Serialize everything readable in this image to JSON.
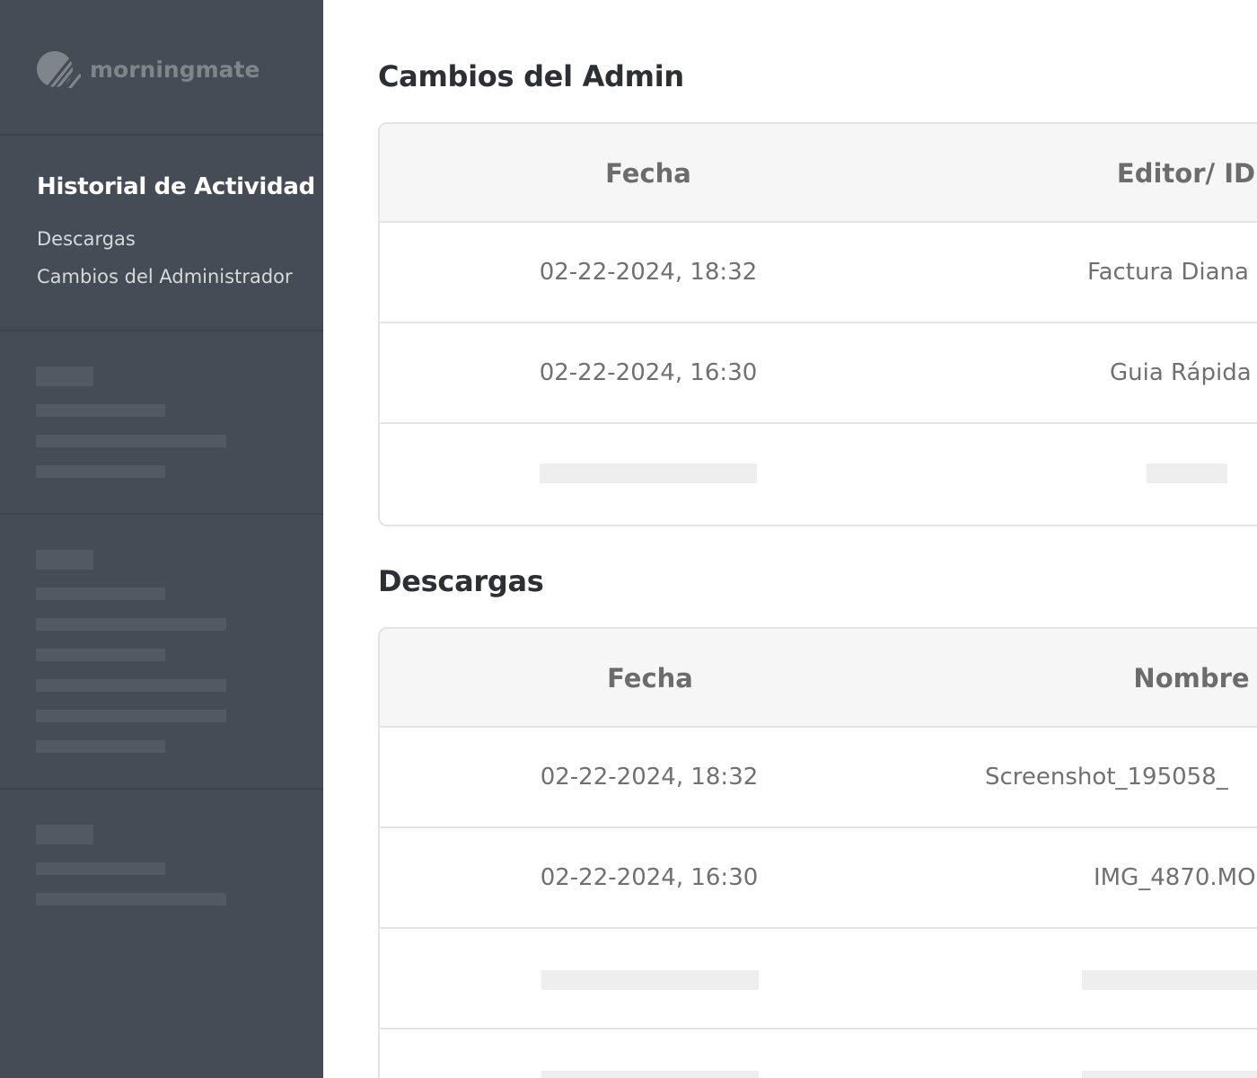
{
  "brand": {
    "name": "morningmate",
    "icon": "morningmate-logo-icon"
  },
  "sidebar": {
    "title": "Historial de Actividad",
    "links": [
      {
        "label": "Descargas"
      },
      {
        "label": "Cambios del Administrador"
      }
    ]
  },
  "admin_changes": {
    "title": "Cambios del Admin",
    "columns": [
      "Fecha",
      "Editor/ ID"
    ],
    "rows": [
      {
        "date": "02-22-2024, 18:32",
        "editor": "Factura Diana"
      },
      {
        "date": "02-22-2024, 16:30",
        "editor": "Guia Rápida"
      }
    ]
  },
  "downloads": {
    "title": "Descargas",
    "columns": [
      "Fecha",
      "Nombre"
    ],
    "rows": [
      {
        "date": "02-22-2024, 18:32",
        "name": "Screenshot_195058_"
      },
      {
        "date": "02-22-2024, 16:30",
        "name": "IMG_4870.MO"
      }
    ]
  },
  "colors": {
    "sidebar_bg": "#464c55",
    "header_bg": "#f6f6f6",
    "border": "#e3e3e3",
    "placeholder": "#eeeeee"
  }
}
